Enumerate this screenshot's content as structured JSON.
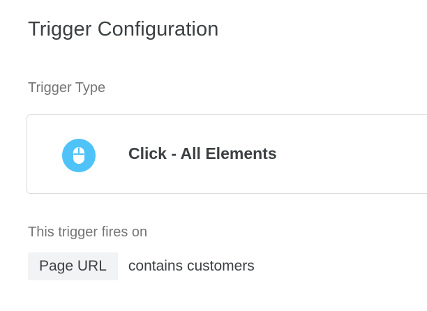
{
  "page": {
    "title": "Trigger Configuration"
  },
  "trigger_type": {
    "label": "Trigger Type",
    "name": "Click - All Elements",
    "icon": "mouse-icon",
    "icon_color": "#4fc3f7"
  },
  "fires_on": {
    "label": "This trigger fires on",
    "variable": "Page URL",
    "condition": "contains customers"
  }
}
